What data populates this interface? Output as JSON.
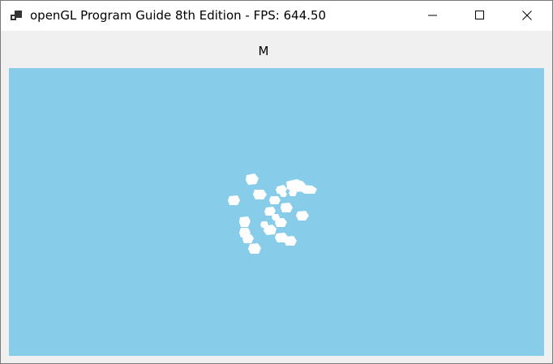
{
  "window": {
    "title": "openGL Program Guide 8th Edition - FPS: 644.50",
    "icon": "app-window-icon",
    "controls": [
      "minimize-icon",
      "maximize-icon",
      "close-icon"
    ]
  },
  "toolbar": {
    "label": "M"
  },
  "scene": {
    "background_color": "#87cdea",
    "object_color": "#ffffff",
    "object_count": 22
  }
}
